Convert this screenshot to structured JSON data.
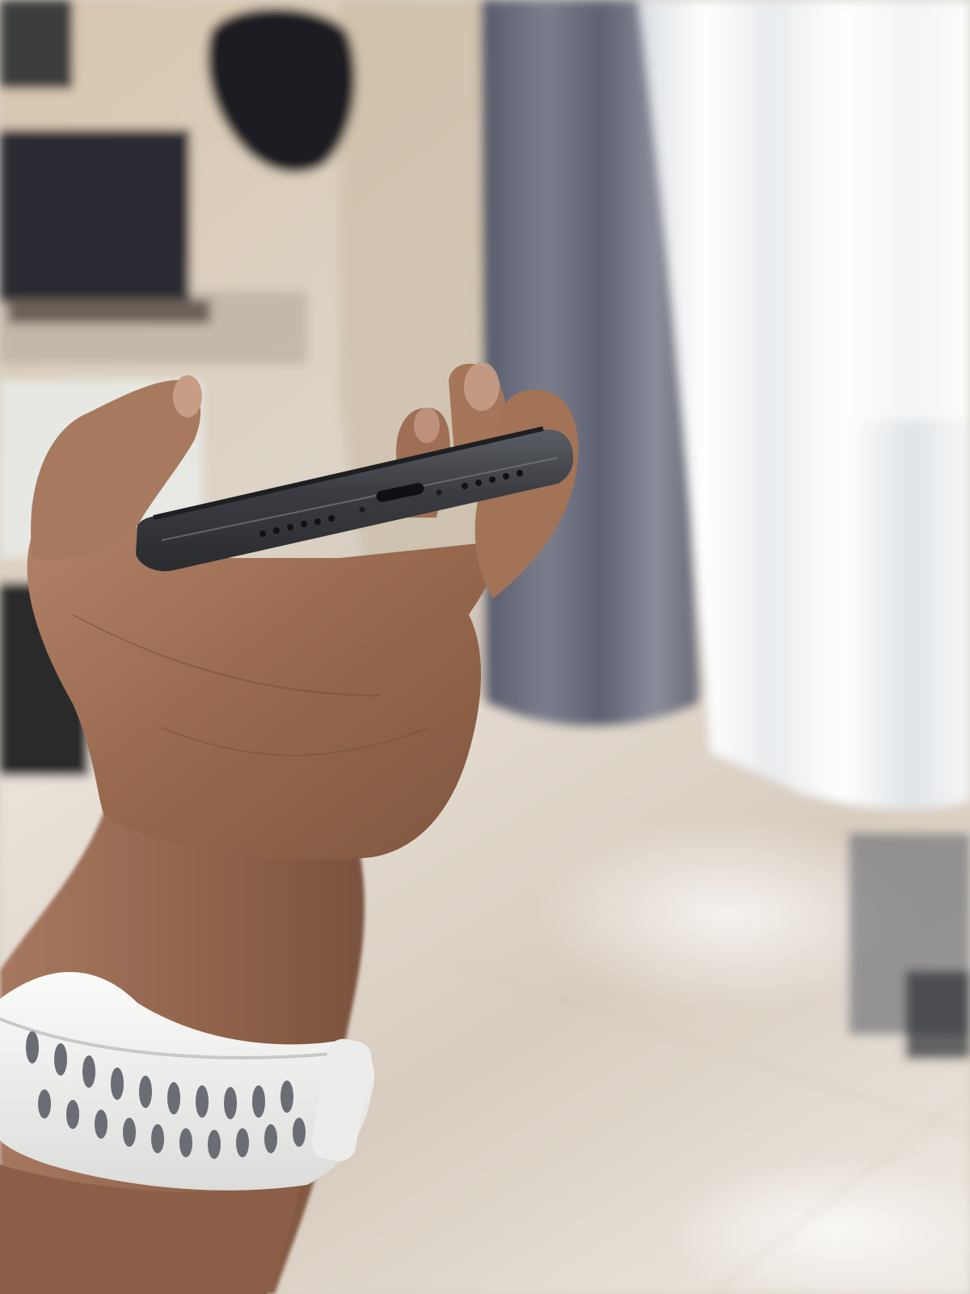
{
  "photo": {
    "subject": "hand-holding-smartphone",
    "has_visible_text": false,
    "colors": {
      "wall": "#d8cfc0",
      "floor": "#e2d9cd",
      "curtain_blue": "#6f7180",
      "curtain_sheer": "#f4f2ee",
      "skin": "#9a6b4f",
      "phone": "#3d3f44",
      "watch_band": "#f1f1ef"
    }
  }
}
